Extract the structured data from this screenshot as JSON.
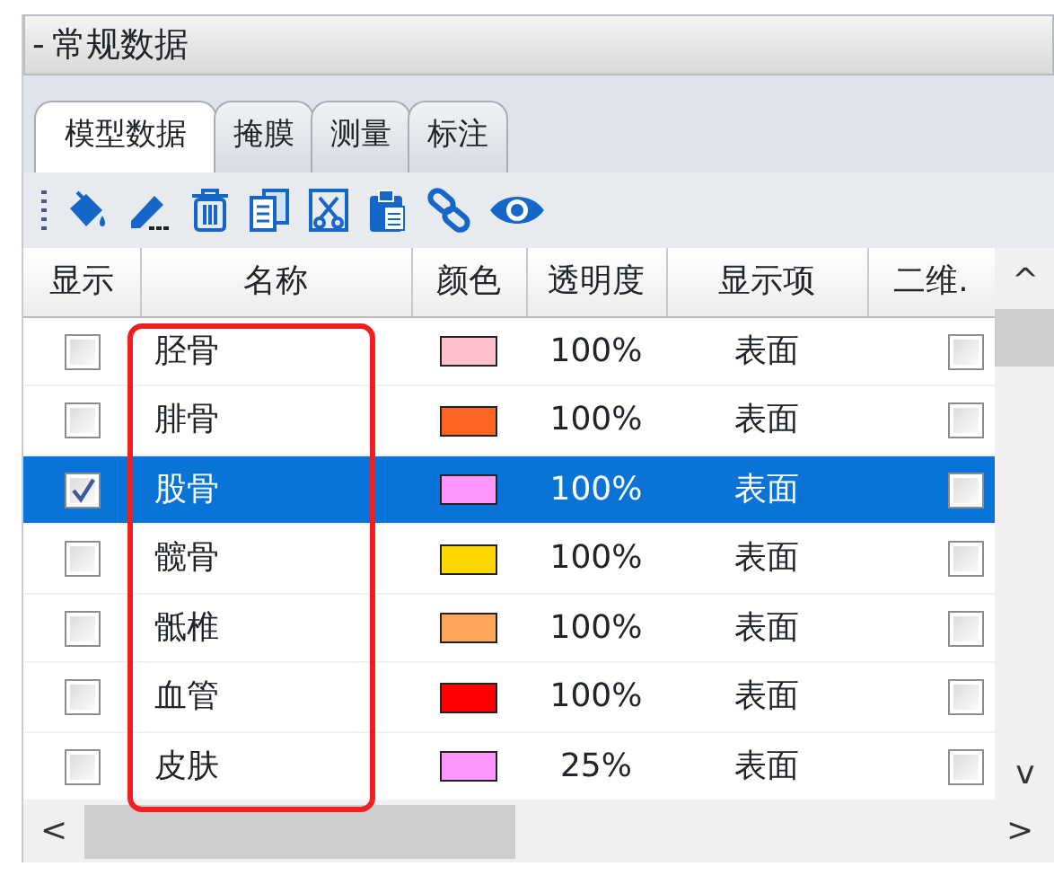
{
  "panel": {
    "collapse_glyph": "-",
    "title": "常规数据"
  },
  "tabs": [
    {
      "label": "模型数据",
      "selected": true
    },
    {
      "label": "掩膜",
      "selected": false
    },
    {
      "label": "测量",
      "selected": false
    },
    {
      "label": "标注",
      "selected": false
    }
  ],
  "table": {
    "columns": [
      "显示",
      "名称",
      "颜色",
      "透明度",
      "显示项",
      "二维."
    ],
    "rows": [
      {
        "visible": false,
        "name": "胫骨",
        "color": "#ffc0cb",
        "opacity": "100%",
        "display": "表面",
        "two_d": false,
        "selected": false
      },
      {
        "visible": false,
        "name": "腓骨",
        "color": "#ff6422",
        "opacity": "100%",
        "display": "表面",
        "two_d": false,
        "selected": false
      },
      {
        "visible": true,
        "name": "股骨",
        "color": "#ff96ff",
        "opacity": "100%",
        "display": "表面",
        "two_d": false,
        "selected": true
      },
      {
        "visible": false,
        "name": "髋骨",
        "color": "#ffd700",
        "opacity": "100%",
        "display": "表面",
        "two_d": false,
        "selected": false
      },
      {
        "visible": false,
        "name": "骶椎",
        "color": "#ffa65a",
        "opacity": "100%",
        "display": "表面",
        "two_d": false,
        "selected": false
      },
      {
        "visible": false,
        "name": "血管",
        "color": "#ff0000",
        "opacity": "100%",
        "display": "表面",
        "two_d": false,
        "selected": false
      },
      {
        "visible": false,
        "name": "皮肤",
        "color": "#ff96ff",
        "opacity": "25%",
        "display": "表面",
        "two_d": false,
        "selected": false
      }
    ]
  },
  "scrollbar": {
    "up": "^",
    "down": "v",
    "left": "<",
    "right": ">"
  }
}
